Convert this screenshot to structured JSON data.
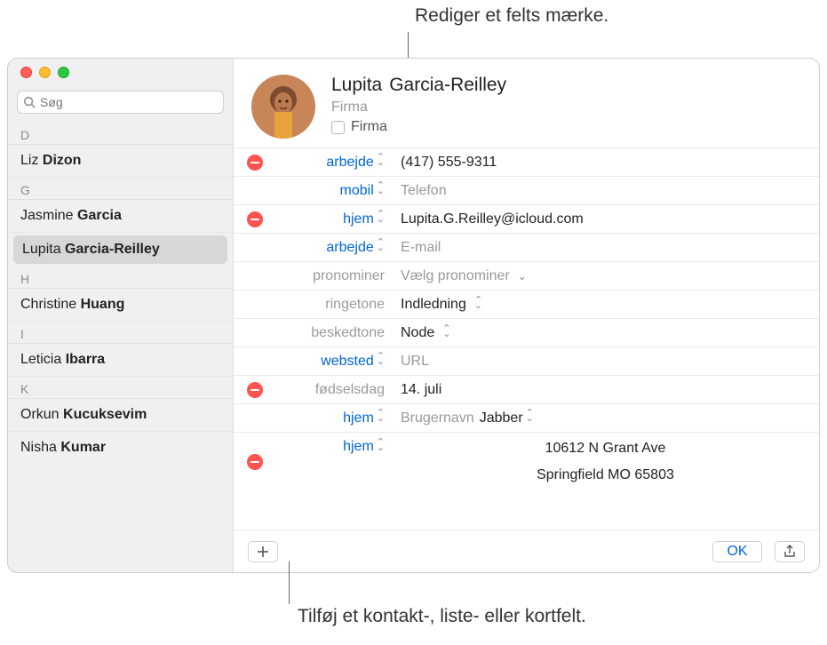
{
  "annotations": {
    "top": "Rediger et felts mærke.",
    "bottom": "Tilføj et kontakt-, liste- eller kortfelt."
  },
  "search": {
    "placeholder": "Søg"
  },
  "sections": [
    {
      "letter": "D",
      "contacts": [
        {
          "first": "Liz",
          "last": "Dizon"
        }
      ]
    },
    {
      "letter": "G",
      "contacts": [
        {
          "first": "Jasmine",
          "last": "Garcia"
        },
        {
          "first": "Lupita",
          "last": "Garcia-Reilley",
          "selected": true
        }
      ]
    },
    {
      "letter": "H",
      "contacts": [
        {
          "first": "Christine",
          "last": "Huang"
        }
      ]
    },
    {
      "letter": "I",
      "contacts": [
        {
          "first": "Leticia",
          "last": "Ibarra"
        }
      ]
    },
    {
      "letter": "K",
      "contacts": [
        {
          "first": "Orkun",
          "last": "Kucuksevim"
        },
        {
          "first": "Nisha",
          "last": "Kumar"
        }
      ]
    }
  ],
  "card": {
    "firstName": "Lupita",
    "lastName": "Garcia-Reilley",
    "companyPlaceholder": "Firma",
    "companyCheckboxLabel": "Firma"
  },
  "fields": {
    "phoneWork": {
      "label": "arbejde",
      "value": "(417) 555-9311"
    },
    "phoneMobile": {
      "label": "mobil",
      "placeholder": "Telefon"
    },
    "emailHome": {
      "label": "hjem",
      "value": "Lupita.G.Reilley@icloud.com"
    },
    "emailWork": {
      "label": "arbejde",
      "placeholder": "E-mail"
    },
    "pronouns": {
      "label": "pronominer",
      "placeholder": "Vælg pronominer"
    },
    "ringtone": {
      "label": "ringetone",
      "value": "Indledning"
    },
    "texttone": {
      "label": "beskedtone",
      "value": "Node"
    },
    "website": {
      "label": "websted",
      "placeholder": "URL"
    },
    "birthday": {
      "label": "fødselsdag",
      "value": "14. juli"
    },
    "im": {
      "label": "hjem",
      "usernameLabel": "Brugernavn",
      "service": "Jabber"
    },
    "address": {
      "label": "hjem",
      "line1": "10612 N Grant Ave",
      "line2": "Springfield MO 65803"
    }
  },
  "footer": {
    "ok": "OK"
  }
}
